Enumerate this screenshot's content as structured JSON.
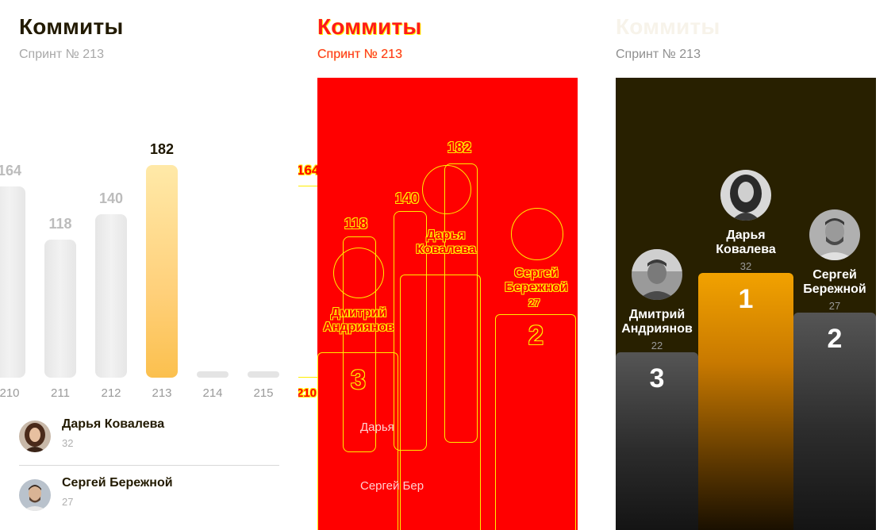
{
  "panels": {
    "chart": {
      "title": "Коммиты",
      "subtitle": "Спринт № 213"
    },
    "glitch": {
      "title": "Коммиты",
      "subtitle": "Спринт № 213",
      "bar_labels": [
        "164",
        "118",
        "140",
        "182"
      ],
      "x_label": "210",
      "people": [
        {
          "name_line1": "Дмитрий",
          "name_line2": "Андриянов",
          "rank": "3"
        },
        {
          "name_line1": "Дарья",
          "name_line2": "Ковалева"
        },
        {
          "name_line1": "Сергей",
          "name_line2": "Бережной",
          "score": "27",
          "rank": "2"
        }
      ],
      "list": [
        "Дарья",
        "Сергей Бер"
      ]
    },
    "podium": {
      "title": "Коммиты",
      "subtitle": "Спринт № 213",
      "places": [
        {
          "name_line1": "Дмитрий",
          "name_line2": "Андриянов",
          "score": "22",
          "rank": "3",
          "color": "#3a3a3a"
        },
        {
          "name_line1": "Дарья",
          "name_line2": "Ковалева",
          "score": "32",
          "rank": "1",
          "color": "#e89a00"
        },
        {
          "name_line1": "Сергей",
          "name_line2": "Бережной",
          "score": "27",
          "rank": "2",
          "color": "#3a3a3a"
        }
      ]
    }
  },
  "chart_data": {
    "type": "bar",
    "categories": [
      "210",
      "211",
      "212",
      "213",
      "214",
      "215"
    ],
    "values": [
      164,
      118,
      140,
      182,
      0,
      0
    ],
    "value_labels": [
      "164",
      "118",
      "140",
      "182",
      "",
      ""
    ],
    "highlight_index": 3,
    "accent_color": "#fbc04e",
    "bar_color": "#e8e8e8",
    "ylim": [
      0,
      200
    ],
    "grid": false
  },
  "leaderboard": [
    {
      "name": "Дарья Ковалева",
      "score": "32"
    },
    {
      "name": "Сергей Бережной",
      "score": "27"
    }
  ],
  "colors": {
    "title_dark": "#221a00",
    "accent": "#fbc04e",
    "podium_bg": "#282000",
    "glitch_red": "#ff0000",
    "glitch_yellow": "#ffee00"
  }
}
